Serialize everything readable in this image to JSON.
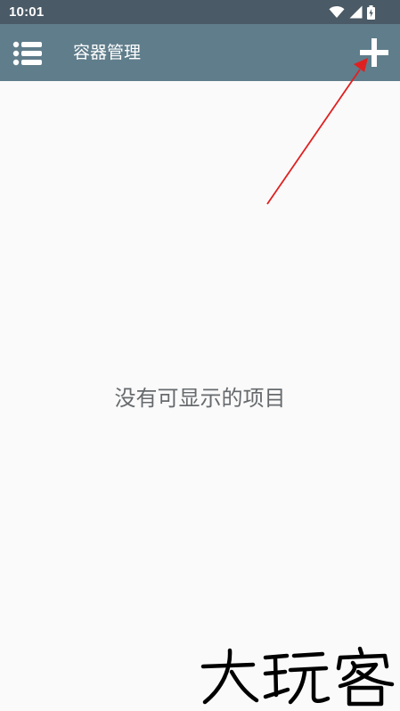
{
  "status_bar": {
    "time": "10:01",
    "icons": [
      "wifi-icon",
      "signal-icon",
      "battery-icon"
    ]
  },
  "app_bar": {
    "title": "容器管理",
    "menu_icon": "list-menu-icon",
    "add_icon": "plus-icon",
    "background": "#607d8b"
  },
  "content": {
    "empty_message": "没有可显示的项目"
  },
  "annotation": {
    "color": "#e02020"
  },
  "watermark": {
    "text": "大玩客"
  }
}
